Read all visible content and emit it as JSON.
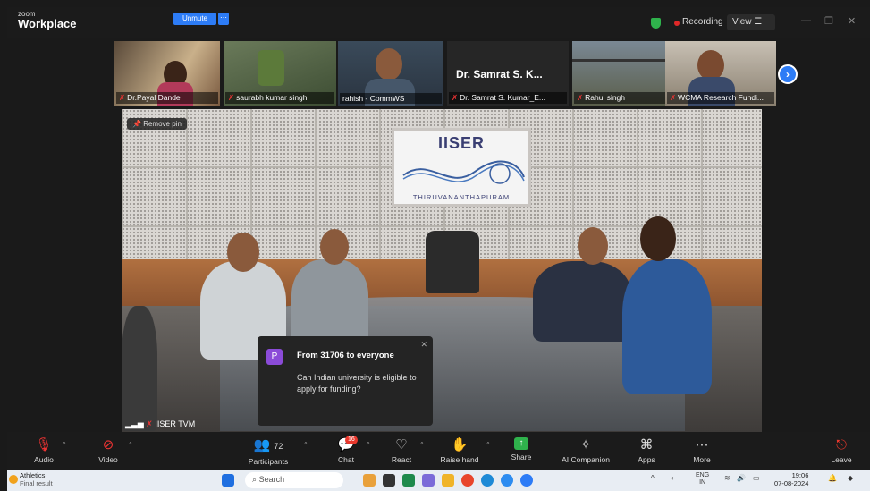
{
  "app": {
    "brand_top": "zoom",
    "brand_name": "Workplace"
  },
  "header": {
    "recording_label": "Recording",
    "view_label": "View",
    "minimize": "—",
    "restore": "❐",
    "close": "✕"
  },
  "thumbnails": [
    {
      "name": "Dr.Payal Dande",
      "muted": true
    },
    {
      "name": "saurabh kumar singh",
      "muted": true,
      "unmute_label": "Unmute"
    },
    {
      "name": "rahish - CommWS",
      "muted": false
    },
    {
      "name": "Dr. Samrat S. Kumar_E...",
      "muted": true,
      "display_name": "Dr. Samrat S. K..."
    },
    {
      "name": "Rahul singh",
      "muted": true
    },
    {
      "name": "WCMA Research Fundi...",
      "muted": true
    }
  ],
  "main_video": {
    "pin_label": "Remove pin",
    "logo_title": "IISER",
    "logo_subtitle": "THIRUVANANTHAPURAM",
    "speaker_name": "IISER TVM"
  },
  "chat_popup": {
    "avatar_letter": "P",
    "from": "From 31706 to everyone",
    "message": "Can Indian university is eligible to apply for funding?"
  },
  "toolbar": {
    "audio": "Audio",
    "video": "Video",
    "participants": "Participants",
    "participants_count": "72",
    "chat": "Chat",
    "chat_badge": "16",
    "react": "React",
    "raise_hand": "Raise hand",
    "share": "Share",
    "ai_companion": "AI Companion",
    "apps": "Apps",
    "more": "More",
    "leave": "Leave"
  },
  "taskbar": {
    "weather_title": "Athletics",
    "weather_sub": "Final result",
    "search_placeholder": "Search",
    "lang_top": "ENG",
    "lang_bottom": "IN",
    "time": "19:06",
    "date": "07-08-2024"
  },
  "colors": {
    "accent": "#2d7cf6",
    "recording": "#e02828",
    "share": "#2fb24c",
    "leave": "#e8372c"
  }
}
